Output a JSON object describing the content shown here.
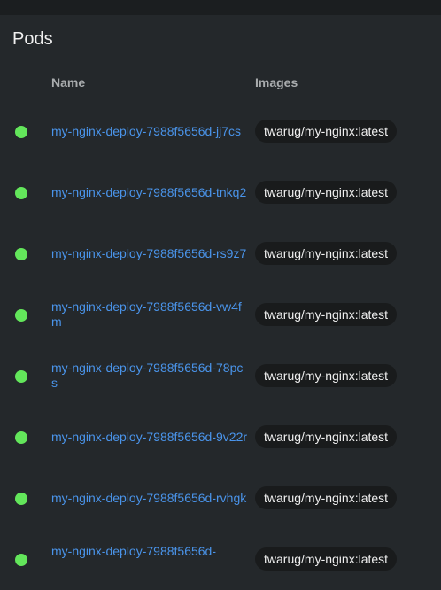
{
  "section_title": "Pods",
  "columns": {
    "name": "Name",
    "images": "Images"
  },
  "pods": [
    {
      "name": "my-nginx-deploy-7988f5656d-jj7cs",
      "image": "twarug/my-nginx:latest",
      "status": "running"
    },
    {
      "name": "my-nginx-deploy-7988f5656d-tnkq2",
      "image": "twarug/my-nginx:latest",
      "status": "running"
    },
    {
      "name": "my-nginx-deploy-7988f5656d-rs9z7",
      "image": "twarug/my-nginx:latest",
      "status": "running"
    },
    {
      "name": "my-nginx-deploy-7988f5656d-vw4fm",
      "image": "twarug/my-nginx:latest",
      "status": "running"
    },
    {
      "name": "my-nginx-deploy-7988f5656d-78pcs",
      "image": "twarug/my-nginx:latest",
      "status": "running"
    },
    {
      "name": "my-nginx-deploy-7988f5656d-9v22r",
      "image": "twarug/my-nginx:latest",
      "status": "running"
    },
    {
      "name": "my-nginx-deploy-7988f5656d-rvhgk",
      "image": "twarug/my-nginx:latest",
      "status": "running"
    },
    {
      "name": "my-nginx-deploy-7988f5656d-",
      "image": "twarug/my-nginx:latest",
      "status": "running"
    }
  ],
  "colors": {
    "status_running": "#63e65b",
    "link": "#4a94ea",
    "background": "#24282b"
  }
}
